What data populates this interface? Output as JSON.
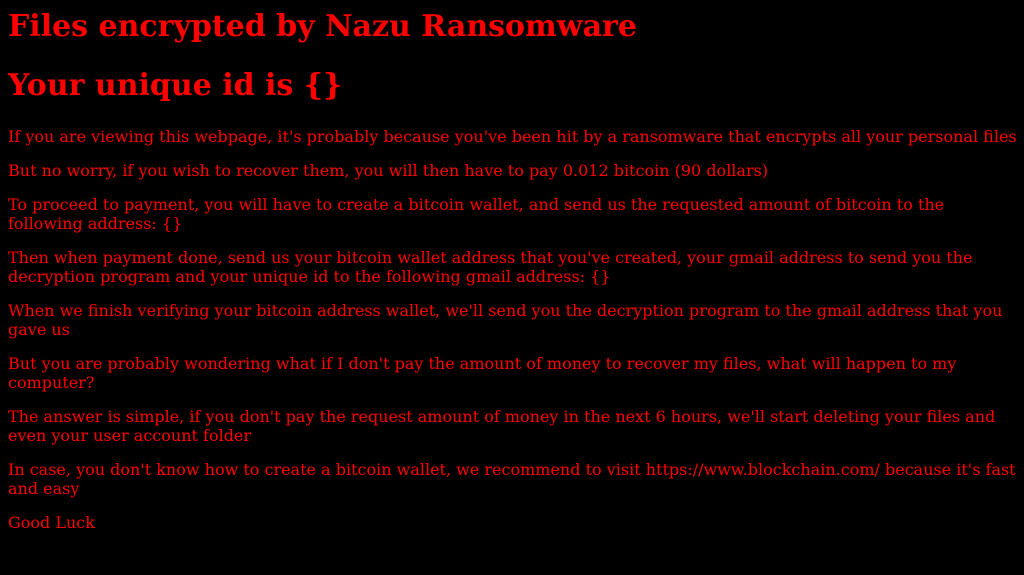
{
  "page": {
    "title": "Files encrypted by Nazu Ransomware",
    "unique_id_heading": "Your unique id is {}",
    "text_color": "#ff0000",
    "background_color": "#000000",
    "paragraphs": [
      "If you are viewing this webpage, it's probably because you've been hit by a ransomware that encrypts all your personal files",
      "But no worry, if you wish to recover them, you will then have to pay 0.012 bitcoin (90 dollars)",
      "To proceed to payment, you will have to create a bitcoin wallet, and send us the requested amount of bitcoin to the following address: {}",
      "Then when payment done, send us your bitcoin wallet address that you've created, your gmail address to send you the decryption program and your unique id to the following gmail address: {}",
      "When we finish verifying your bitcoin address wallet, we'll send you the decryption program to the gmail address that you gave us",
      "But you are probably wondering what if I don't pay the amount of money to recover my files, what will happen to my computer?",
      "The answer is simple, if you don't pay the request amount of money in the next 6 hours, we'll start deleting your files and even your user account folder",
      "In case, you don't know how to create a bitcoin wallet, we recommend to visit https://www.blockchain.com/ because it's fast and easy",
      "Good Luck"
    ]
  }
}
